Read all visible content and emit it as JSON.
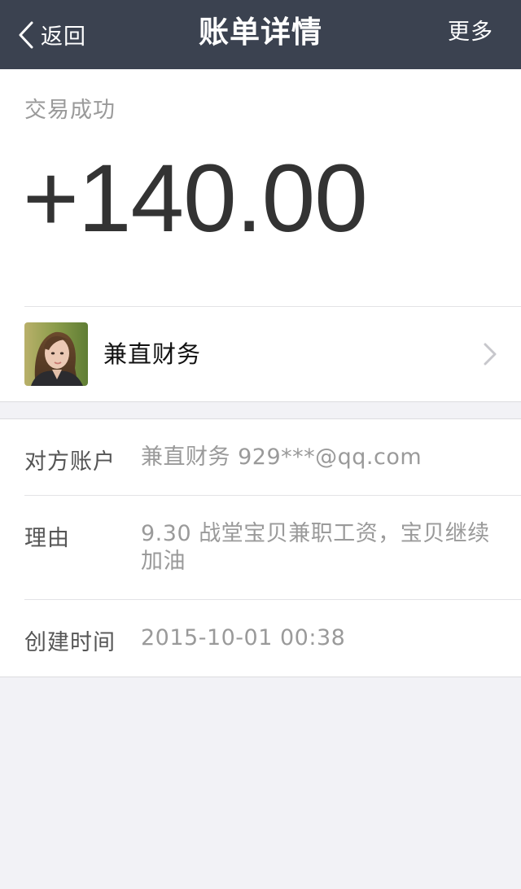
{
  "nav": {
    "back_label": "返回",
    "title": "账单详情",
    "more_label": "更多"
  },
  "summary": {
    "status": "交易成功",
    "amount": "+140.00"
  },
  "payer": {
    "name": "兼直财务",
    "avatar_icon": "user-photo-avatar"
  },
  "details": [
    {
      "label": "对方账户",
      "value": "兼直财务 929***@qq.com"
    },
    {
      "label": "理由",
      "value": "9.30 战堂宝贝兼职工资，宝贝继续加油"
    },
    {
      "label": "创建时间",
      "value": "2015-10-01 00:38"
    }
  ],
  "colors": {
    "navbar_bg": "#3b4250",
    "page_bg": "#f2f2f6",
    "card_bg": "#ffffff",
    "amount_text": "#333333",
    "muted_text": "#9a9a9a"
  },
  "icons": {
    "back": "chevron-left-icon",
    "row_arrow": "chevron-right-icon"
  }
}
